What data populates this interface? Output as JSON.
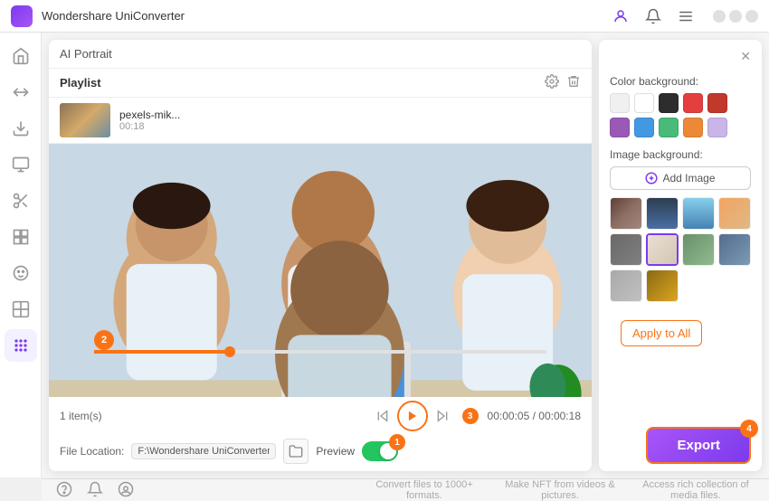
{
  "app": {
    "title": "Wondershare UniConverter"
  },
  "titlebar": {
    "user_icon": "👤",
    "bell_icon": "🔔",
    "menu_icon": "≡"
  },
  "sidebar": {
    "items": [
      {
        "id": "home",
        "icon": "⌂",
        "active": false
      },
      {
        "id": "convert",
        "icon": "⬇",
        "active": false
      },
      {
        "id": "download",
        "icon": "↓",
        "active": false
      },
      {
        "id": "screen",
        "icon": "🖥",
        "active": false
      },
      {
        "id": "scissors",
        "icon": "✂",
        "active": false
      },
      {
        "id": "grid1",
        "icon": "⊞",
        "active": false
      },
      {
        "id": "face",
        "icon": "◎",
        "active": false
      },
      {
        "id": "grid2",
        "icon": "⊟",
        "active": false
      },
      {
        "id": "apps",
        "icon": "⊞",
        "active": true
      }
    ]
  },
  "panel": {
    "title": "AI Portrait",
    "playlist": {
      "label": "Playlist",
      "items": [
        {
          "name": "pexels-mik...",
          "duration": "00:18"
        }
      ]
    }
  },
  "controls": {
    "items_count": "1 item(s)",
    "time_current": "00:00:05",
    "time_total": "00:00:18",
    "file_location_label": "File Location:",
    "file_location_value": "F:\\Wondershare UniConverter",
    "preview_label": "Preview",
    "badge_2": "2",
    "badge_3": "3",
    "badge_4": "4",
    "badge_1": "1"
  },
  "right_panel": {
    "color_background_label": "Color background:",
    "colors": [
      {
        "hex": "#f0f0f0",
        "name": "light-gray"
      },
      {
        "hex": "#ffffff",
        "name": "white"
      },
      {
        "hex": "#2d2d2d",
        "name": "dark"
      },
      {
        "hex": "#e53e3e",
        "name": "red"
      },
      {
        "hex": "#c0392b",
        "name": "dark-red"
      },
      {
        "hex": "#9b59b6",
        "name": "purple"
      },
      {
        "hex": "#4299e1",
        "name": "blue"
      },
      {
        "hex": "#48bb78",
        "name": "green"
      },
      {
        "hex": "#ed8936",
        "name": "orange"
      },
      {
        "hex": "#c9b5e8",
        "name": "light-purple"
      }
    ],
    "image_background_label": "Image background:",
    "add_image_label": "Add Image",
    "bg_images": [
      {
        "id": "bg1",
        "color1": "#8B4513",
        "color2": "#D2691E",
        "selected": false
      },
      {
        "id": "bg2",
        "color1": "#2c3e50",
        "color2": "#4a6fa5",
        "selected": false
      },
      {
        "id": "bg3",
        "color1": "#87CEEB",
        "color2": "#4682B4",
        "selected": false
      },
      {
        "id": "bg4",
        "color1": "#F4A460",
        "color2": "#DEB887",
        "selected": false
      },
      {
        "id": "bg5",
        "color1": "#696969",
        "color2": "#808080",
        "selected": false
      },
      {
        "id": "bg6",
        "color1": "#e8e0d5",
        "color2": "#d4c5b0",
        "selected": true
      },
      {
        "id": "bg7",
        "color1": "#6B8E6B",
        "color2": "#8FBC8F",
        "selected": false
      },
      {
        "id": "bg8",
        "color1": "#556B8D",
        "color2": "#7B9BB5",
        "selected": false
      },
      {
        "id": "bg9",
        "color1": "#A9A9A9",
        "color2": "#C0C0C0",
        "selected": false
      },
      {
        "id": "bg10",
        "color1": "#8B6914",
        "color2": "#DAA520",
        "selected": false
      }
    ],
    "apply_btn_label": "Apply to All",
    "export_btn_label": "Export"
  },
  "bottom_bar": {
    "items": [
      "Convert files to 1000+ formats.",
      "Make NFT from videos & pictures.",
      "Access rich collection of media files."
    ]
  }
}
